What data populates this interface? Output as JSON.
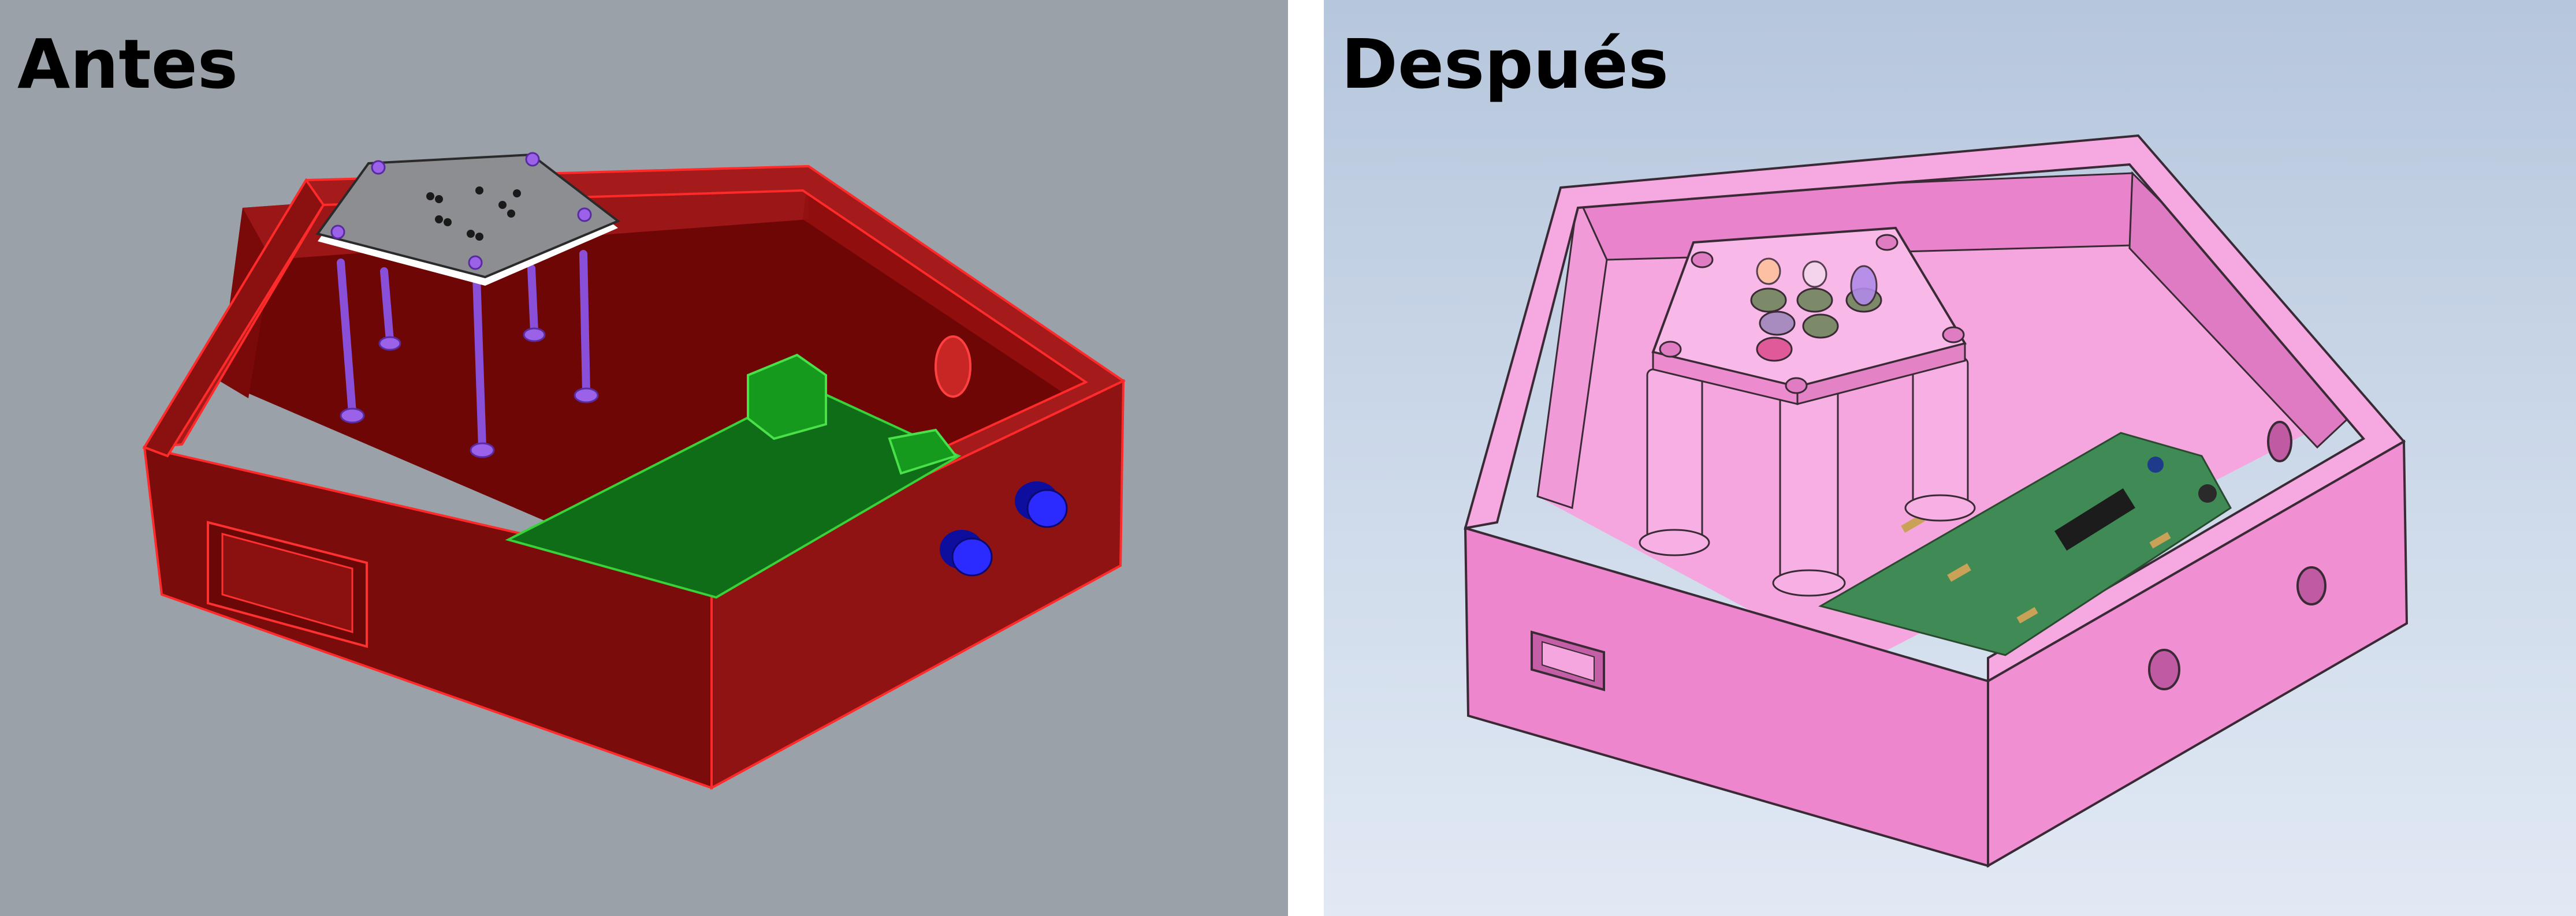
{
  "panels": {
    "before": {
      "label": "Antes",
      "background": "#9ba1a8",
      "enclosure_color": "#8b0d0d",
      "board_color": "#0d6b14",
      "post_color": "#8a4fd8",
      "knob_color": "#1818e0"
    },
    "after": {
      "label": "Después",
      "background": "#c6d3e5",
      "enclosure_color": "#f28fd3",
      "board_color": "#3f8a55"
    }
  }
}
